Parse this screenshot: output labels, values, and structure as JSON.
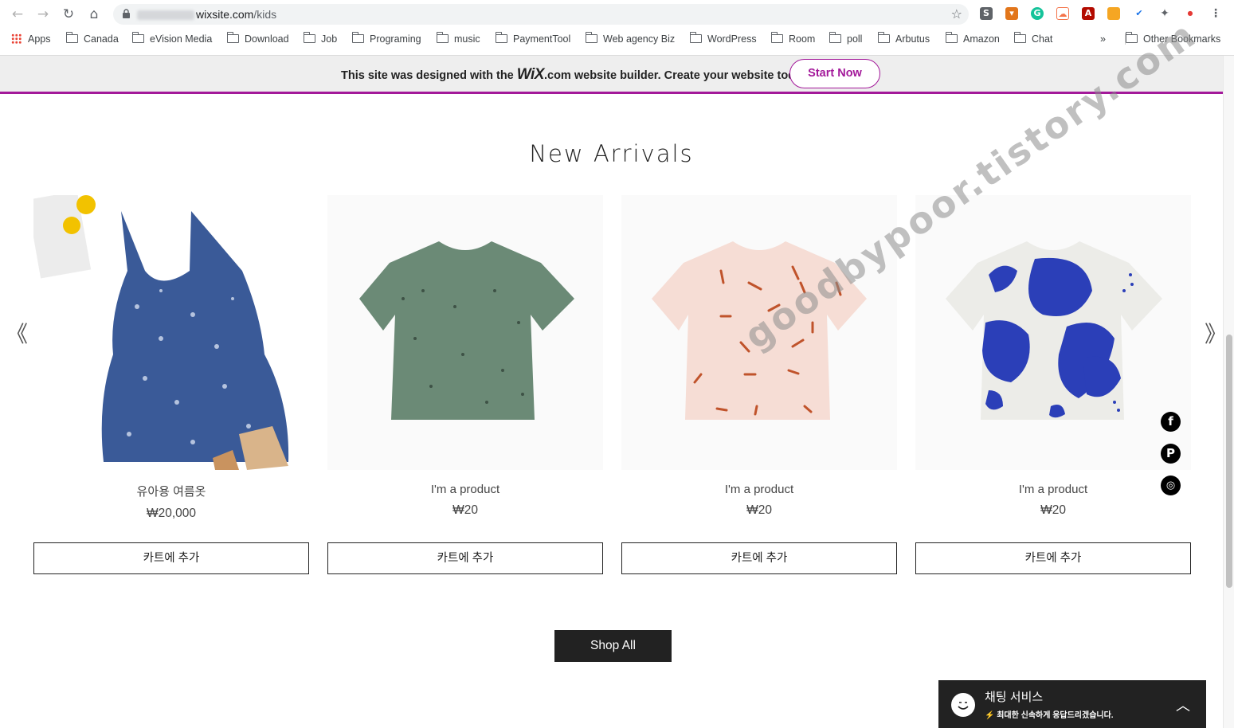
{
  "browser": {
    "url_host": "wixsite.com",
    "url_path": "/kids",
    "bookmarks": [
      "Apps",
      "Canada",
      "eVision Media",
      "Download",
      "Job",
      "Programing",
      "music",
      "PaymentTool",
      "Web agency Biz",
      "WordPress",
      "Room",
      "poll",
      "Arbutus",
      "Amazon",
      "Chat"
    ],
    "more_label": "»",
    "other_bookmarks": "Other Bookmarks"
  },
  "wix_banner": {
    "text_before": "This site was designed with the ",
    "logo": "WiX",
    "text_after": ".com website builder. Create your website today.",
    "button": "Start Now",
    "accent": "#a3199a"
  },
  "section": {
    "title": "New Arrivals"
  },
  "products": [
    {
      "name": "유아용 여름옷",
      "price": "₩20,000",
      "button": "카트에 추가",
      "image": "blue-floral-dress"
    },
    {
      "name": "I'm a product",
      "price": "₩20",
      "button": "카트에 추가",
      "image": "green-tshirt"
    },
    {
      "name": "I'm a product",
      "price": "₩20",
      "button": "카트에 추가",
      "image": "pink-tshirt"
    },
    {
      "name": "I'm a product",
      "price": "₩20",
      "button": "카트에 추가",
      "image": "blue-pattern-tshirt"
    }
  ],
  "carousel": {
    "prev": "《",
    "next": "》"
  },
  "shop_all": "Shop All",
  "social": [
    "facebook-icon",
    "pinterest-icon",
    "instagram-icon"
  ],
  "chat": {
    "title": "채팅 서비스",
    "subtitle": "최대한 신속하게 응답드리겠습니다."
  },
  "watermark": "goodbypoor.tistory.com"
}
